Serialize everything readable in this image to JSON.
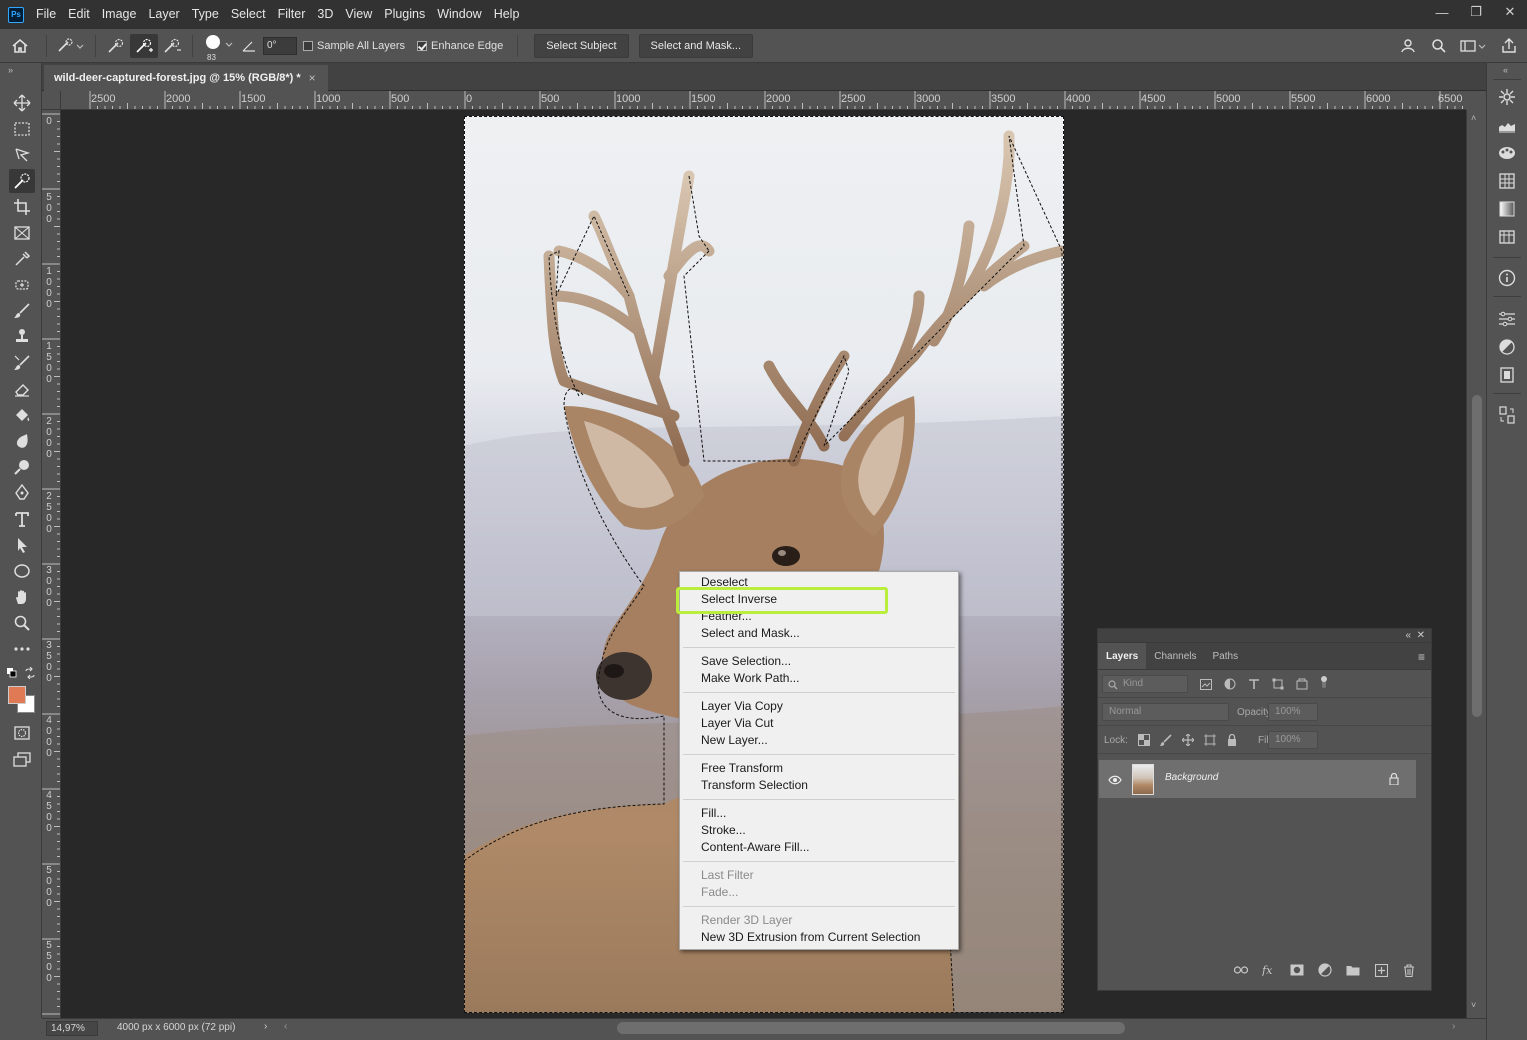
{
  "menubar": {
    "logo": "Ps",
    "items": [
      "File",
      "Edit",
      "Image",
      "Layer",
      "Type",
      "Select",
      "Filter",
      "3D",
      "View",
      "Plugins",
      "Window",
      "Help"
    ],
    "win_minimize": "—",
    "win_restore": "❐",
    "win_close": "✕"
  },
  "options": {
    "brush_size": "83",
    "angle_value": "0°",
    "sample_all_layers": "Sample All Layers",
    "sample_all_layers_checked": false,
    "enhance_edge": "Enhance Edge",
    "enhance_edge_checked": true,
    "select_subject": "Select Subject",
    "select_and_mask": "Select and Mask..."
  },
  "document": {
    "tab_title": "wild-deer-captured-forest.jpg @ 15% (RGB/8*) *",
    "tab_close": "×",
    "zoom": "14,97%",
    "info": "4000 px x 6000 px (72 ppi)"
  },
  "rulers": {
    "horizontal": [
      "2500",
      "2000",
      "1500",
      "1000",
      "500",
      "0",
      "500",
      "1000",
      "1500",
      "2000",
      "2500",
      "3000",
      "3500",
      "4000",
      "4500",
      "5000",
      "5500",
      "6000",
      "6500"
    ],
    "vertical": [
      "0",
      "5\n0\n0",
      "1\n0\n0\n0",
      "1\n5\n0\n0",
      "2\n0\n0\n0",
      "2\n5\n0\n0",
      "3\n0\n0\n0",
      "3\n5\n0\n0",
      "4\n0\n0\n0",
      "4\n5\n0\n0",
      "5\n0\n0\n0",
      "5\n5\n0\n0"
    ]
  },
  "context_menu": {
    "highlight_color": "#b9ef3c",
    "items": [
      {
        "label": "Deselect",
        "disabled": false
      },
      {
        "label": "Select Inverse",
        "disabled": false
      },
      {
        "label": "Feather...",
        "disabled": false
      },
      {
        "label": "Select and Mask...",
        "disabled": false
      },
      {
        "label": "Save Selection...",
        "disabled": false
      },
      {
        "label": "Make Work Path...",
        "disabled": false
      },
      {
        "label": "Layer Via Copy",
        "disabled": false
      },
      {
        "label": "Layer Via Cut",
        "disabled": false
      },
      {
        "label": "New Layer...",
        "disabled": false
      },
      {
        "label": "Free Transform",
        "disabled": false
      },
      {
        "label": "Transform Selection",
        "disabled": false
      },
      {
        "label": "Fill...",
        "disabled": false
      },
      {
        "label": "Stroke...",
        "disabled": false
      },
      {
        "label": "Content-Aware Fill...",
        "disabled": false
      },
      {
        "label": "Last Filter",
        "disabled": true
      },
      {
        "label": "Fade...",
        "disabled": true
      },
      {
        "label": "Render 3D Layer",
        "disabled": true
      },
      {
        "label": "New 3D Extrusion from Current Selection",
        "disabled": false
      }
    ]
  },
  "layers_panel": {
    "collapse": "«",
    "close": "✕",
    "tabs": [
      "Layers",
      "Channels",
      "Paths"
    ],
    "filter_kind": "Kind",
    "blend_mode": "Normal",
    "opacity_label": "Opacity:",
    "opacity_value": "100%",
    "lock_label": "Lock:",
    "fill_label": "Fill:",
    "fill_value": "100%",
    "layer_name": "Background",
    "menu_icon": "≡"
  },
  "colors": {
    "foreground": "#e07a55",
    "background": "#ffffff"
  }
}
